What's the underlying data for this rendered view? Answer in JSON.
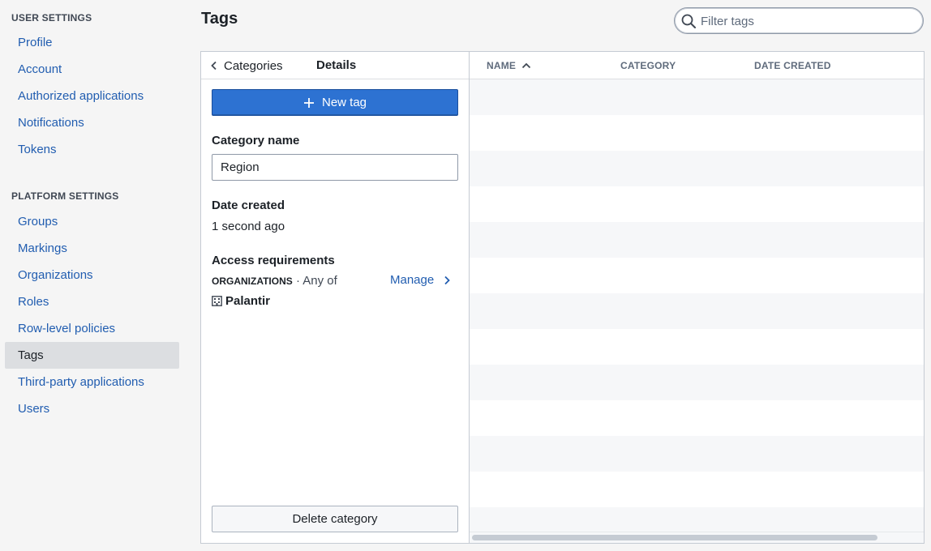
{
  "sidebar": {
    "user_heading": "USER SETTINGS",
    "user_items": [
      "Profile",
      "Account",
      "Authorized applications",
      "Notifications",
      "Tokens"
    ],
    "platform_heading": "PLATFORM SETTINGS",
    "platform_items": [
      "Groups",
      "Markings",
      "Organizations",
      "Roles",
      "Row-level policies",
      "Tags",
      "Third-party applications",
      "Users"
    ],
    "active_item": "Tags"
  },
  "header": {
    "title": "Tags",
    "filter_placeholder": "Filter tags"
  },
  "details": {
    "back_label": "Categories",
    "tab_label": "Details",
    "new_tag_label": "New tag",
    "category_name_label": "Category name",
    "category_name_value": "Region",
    "date_created_label": "Date created",
    "date_created_value": "1 second ago",
    "access_label": "Access requirements",
    "org_caps": "ORGANIZATIONS",
    "org_suffix": " · Any of",
    "manage_label": "Manage",
    "org_name": "Palantir",
    "delete_label": "Delete category"
  },
  "table": {
    "columns": [
      "NAME",
      "CATEGORY",
      "DATE CREATED"
    ],
    "sort_column": "NAME",
    "sort_direction": "ascending",
    "rows": []
  },
  "colors": {
    "accent": "#2d72d2",
    "link": "#215db0",
    "active_bg": "#dcdee1"
  }
}
